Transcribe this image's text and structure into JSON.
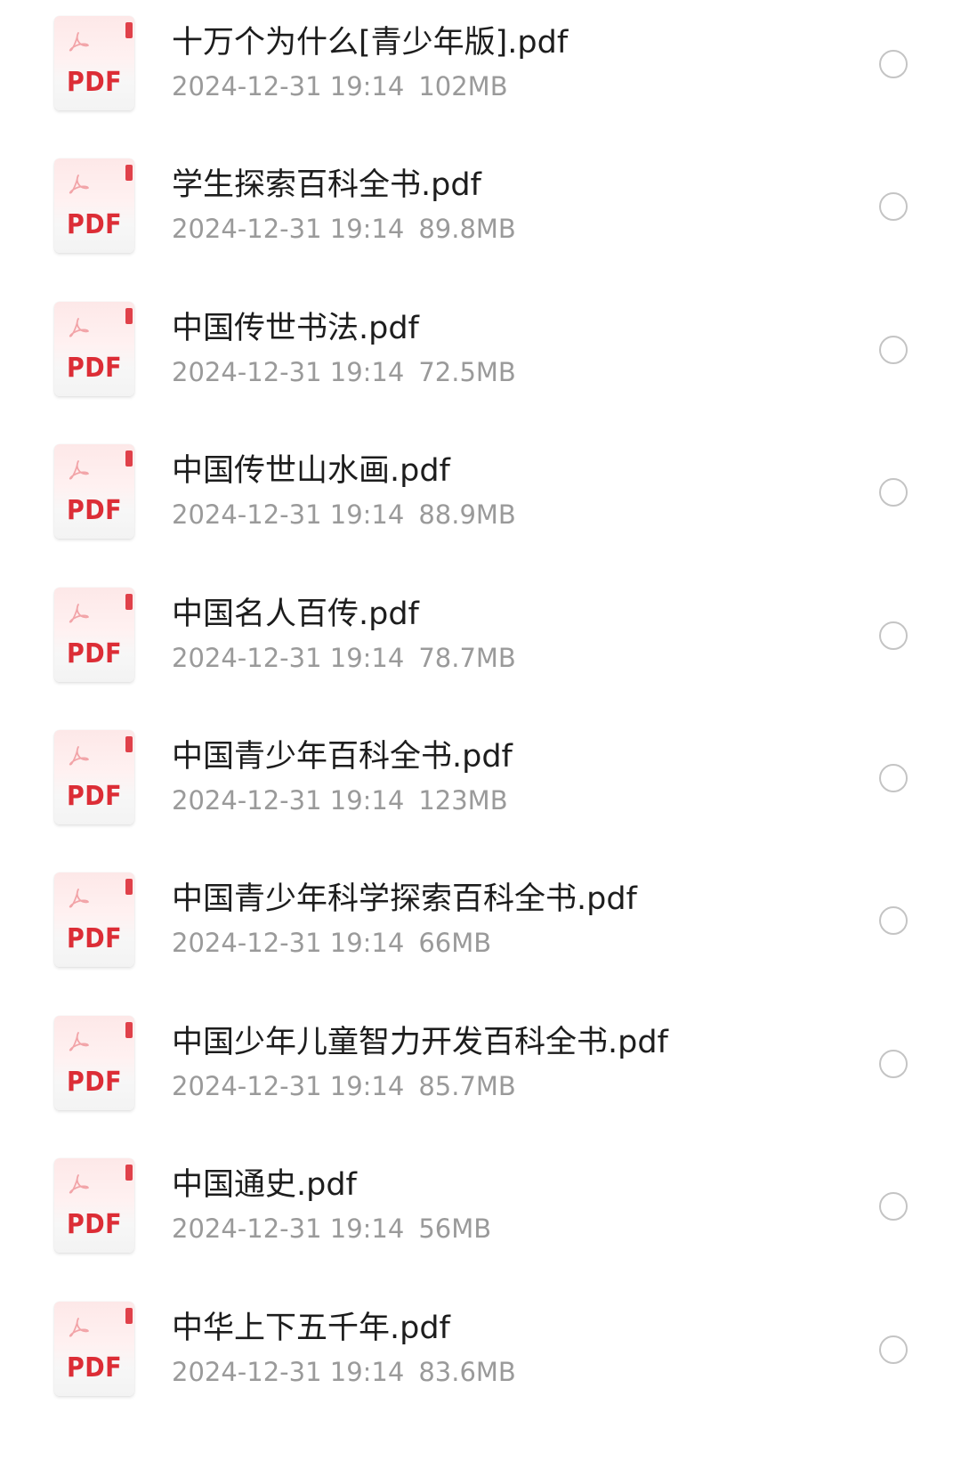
{
  "files": [
    {
      "name": "十万个为什么[青少年版].pdf",
      "date": "2024-12-31 19:14",
      "size": "102MB",
      "icon_label": "PDF",
      "selected": false
    },
    {
      "name": "学生探索百科全书.pdf",
      "date": "2024-12-31 19:14",
      "size": "89.8MB",
      "icon_label": "PDF",
      "selected": false
    },
    {
      "name": "中国传世书法.pdf",
      "date": "2024-12-31 19:14",
      "size": "72.5MB",
      "icon_label": "PDF",
      "selected": false
    },
    {
      "name": "中国传世山水画.pdf",
      "date": "2024-12-31 19:14",
      "size": "88.9MB",
      "icon_label": "PDF",
      "selected": false
    },
    {
      "name": "中国名人百传.pdf",
      "date": "2024-12-31 19:14",
      "size": "78.7MB",
      "icon_label": "PDF",
      "selected": false
    },
    {
      "name": "中国青少年百科全书.pdf",
      "date": "2024-12-31 19:14",
      "size": "123MB",
      "icon_label": "PDF",
      "selected": false
    },
    {
      "name": "中国青少年科学探索百科全书.pdf",
      "date": "2024-12-31 19:14",
      "size": "66MB",
      "icon_label": "PDF",
      "selected": false
    },
    {
      "name": "中国少年儿童智力开发百科全书.pdf",
      "date": "2024-12-31 19:14",
      "size": "85.7MB",
      "icon_label": "PDF",
      "selected": false
    },
    {
      "name": "中国通史.pdf",
      "date": "2024-12-31 19:14",
      "size": "56MB",
      "icon_label": "PDF",
      "selected": false
    },
    {
      "name": "中华上下五千年.pdf",
      "date": "2024-12-31 19:14",
      "size": "83.6MB",
      "icon_label": "PDF",
      "selected": false
    }
  ],
  "colors": {
    "pdf_red": "#dc2d36",
    "title_text": "#1d1d1d",
    "meta_text": "#9a9a9a",
    "radio_border": "#c4c4c4"
  },
  "icons": {
    "file_type": "pdf-file-icon",
    "select": "radio-unchecked-icon"
  }
}
